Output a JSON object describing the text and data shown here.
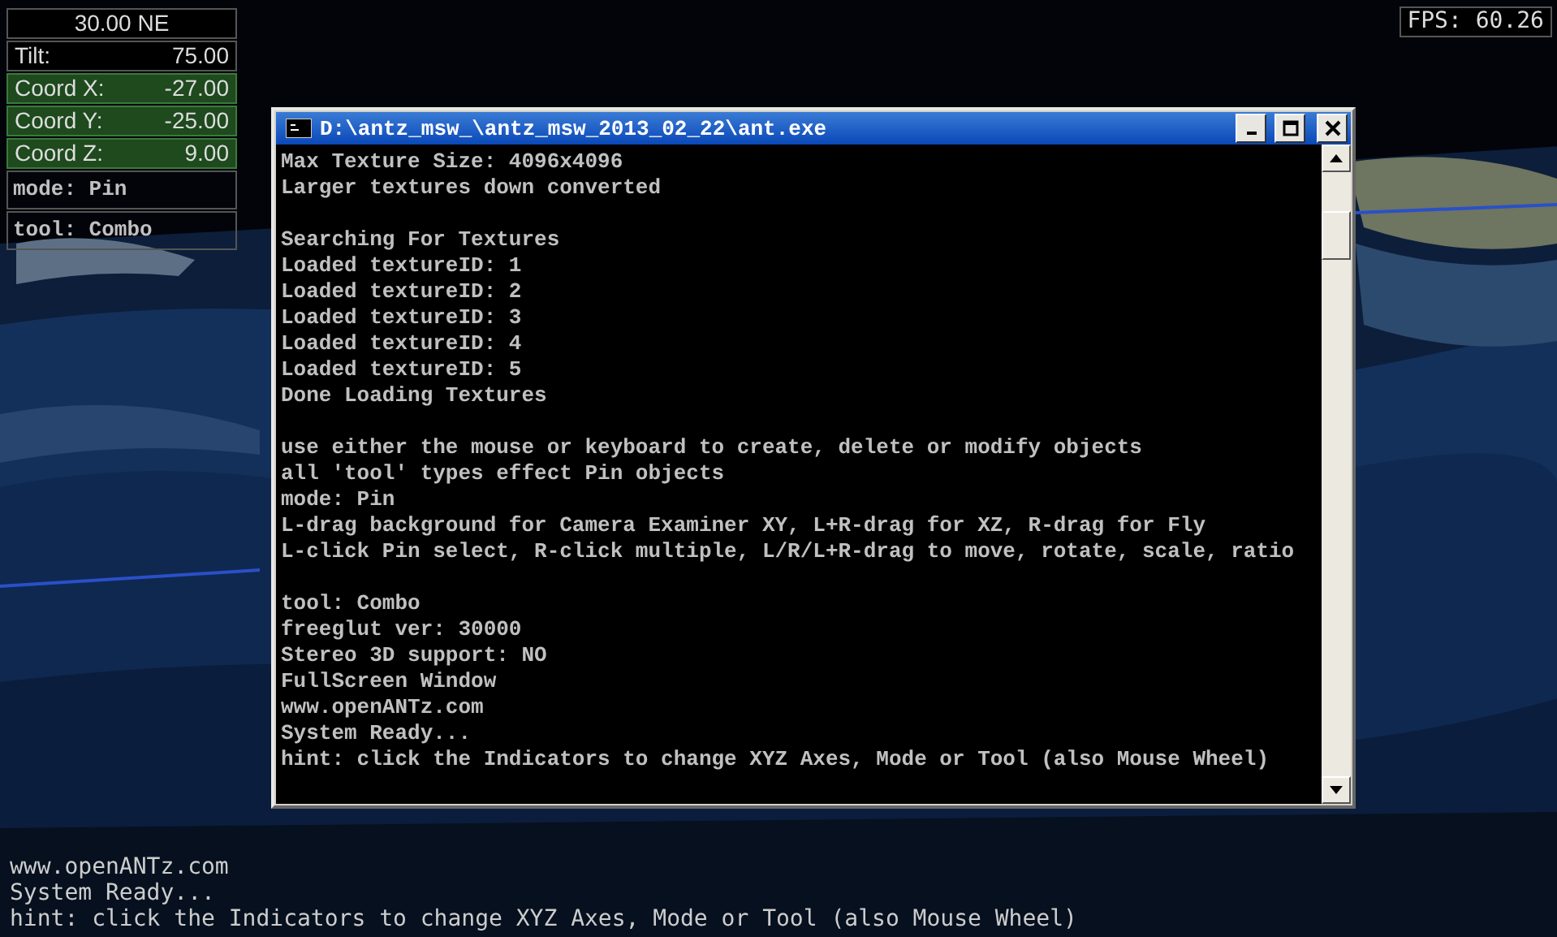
{
  "indicators": [
    {
      "kind": "heading",
      "text": "30.00 NE"
    },
    {
      "kind": "value",
      "label": "Tilt:",
      "value": "75.00"
    },
    {
      "kind": "coord",
      "label": "Coord X:",
      "value": "-27.00"
    },
    {
      "kind": "coord",
      "label": "Coord Y:",
      "value": "-25.00"
    },
    {
      "kind": "coord",
      "label": "Coord Z:",
      "value": "9.00"
    },
    {
      "kind": "text",
      "text": "mode: Pin"
    },
    {
      "kind": "text",
      "text": "tool: Combo"
    }
  ],
  "fps": "FPS: 60.26",
  "console": {
    "title": "D:\\antz_msw_\\antz_msw_2013_02_22\\ant.exe",
    "paragraphs": [
      [
        "Max Texture Size: 4096x4096",
        "Larger textures down converted"
      ],
      [
        "Searching For Textures",
        "Loaded textureID: 1",
        "Loaded textureID: 2",
        "Loaded textureID: 3",
        "Loaded textureID: 4",
        "Loaded textureID: 5",
        "Done Loading Textures"
      ],
      [
        "use either the mouse or keyboard to create, delete or modify objects",
        "all 'tool' types effect Pin objects",
        "mode: Pin",
        "L-drag background for Camera Examiner XY, L+R-drag for XZ, R-drag for Fly",
        "L-click Pin select, R-click multiple, L/R/L+R-drag to move, rotate, scale, ratio"
      ],
      [
        "tool: Combo",
        "freeglut ver: 30000",
        "Stereo 3D support: NO",
        "FullScreen Window",
        "www.openANTz.com",
        "System Ready...",
        "hint: click the Indicators to change XYZ Axes, Mode or Tool (also Mouse Wheel)"
      ]
    ]
  },
  "status_lines": [
    "www.openANTz.com",
    "System Ready...",
    "hint: click the Indicators to change XYZ Axes, Mode or Tool (also Mouse Wheel)"
  ]
}
